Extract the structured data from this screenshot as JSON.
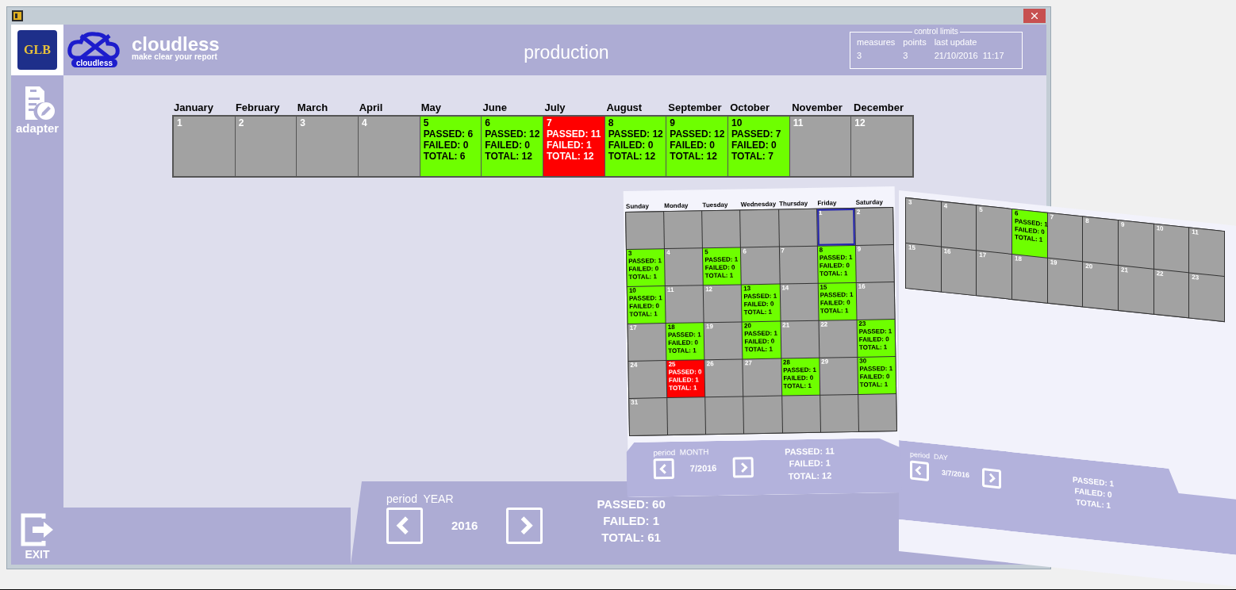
{
  "header": {
    "logo_text": "GLB",
    "brand_badge": "cloudless",
    "brand_name": "cloudless",
    "tagline": "make clear your report",
    "title": "production",
    "control_limits": {
      "legend": "control limits",
      "columns": [
        {
          "label": "measures",
          "value": "3"
        },
        {
          "label": "points",
          "value": "3"
        },
        {
          "label": "last update",
          "value": "21/10/2016  11:17"
        }
      ]
    }
  },
  "sidebar": {
    "items": [
      {
        "kind": "adapter",
        "label": "adapter"
      },
      {
        "kind": "exit",
        "label": "EXIT"
      }
    ]
  },
  "year_view": {
    "months": [
      {
        "name": "January",
        "number": "1",
        "kind": "empty",
        "color": "#a2a2a2"
      },
      {
        "name": "February",
        "number": "2",
        "kind": "empty",
        "color": "#a2a2a2"
      },
      {
        "name": "March",
        "number": "3",
        "kind": "empty",
        "color": "#a2a2a2"
      },
      {
        "name": "April",
        "number": "4",
        "kind": "empty",
        "color": "#a2a2a2"
      },
      {
        "name": "May",
        "number": "5",
        "kind": "pass",
        "color": "#6eff00",
        "lines": [
          "PASSED: 6",
          "FAILED: 0",
          "TOTAL: 6"
        ]
      },
      {
        "name": "June",
        "number": "6",
        "kind": "pass",
        "color": "#6eff00",
        "lines": [
          "PASSED: 12",
          "FAILED: 0",
          "TOTAL: 12"
        ]
      },
      {
        "name": "July",
        "number": "7",
        "kind": "fail",
        "color": "#ff0000",
        "lines": [
          "PASSED: 11",
          "FAILED: 1",
          "TOTAL: 12"
        ]
      },
      {
        "name": "August",
        "number": "8",
        "kind": "pass",
        "color": "#6eff00",
        "lines": [
          "PASSED: 12",
          "FAILED: 0",
          "TOTAL: 12"
        ]
      },
      {
        "name": "September",
        "number": "9",
        "kind": "pass",
        "color": "#6eff00",
        "lines": [
          "PASSED: 12",
          "FAILED: 0",
          "TOTAL: 12"
        ]
      },
      {
        "name": "October",
        "number": "10",
        "kind": "pass",
        "color": "#6eff00",
        "lines": [
          "PASSED: 7",
          "FAILED: 0",
          "TOTAL: 7"
        ]
      },
      {
        "name": "November",
        "number": "11",
        "kind": "empty",
        "color": "#a2a2a2"
      },
      {
        "name": "December",
        "number": "12",
        "kind": "empty",
        "color": "#a2a2a2"
      }
    ],
    "footer": {
      "period_label": "period",
      "period_value": "YEAR",
      "value": "2016",
      "totals": [
        "PASSED: 60",
        "FAILED: 1",
        "TOTAL: 61"
      ]
    }
  },
  "month_view": {
    "weekdays": [
      "Sunday",
      "Monday",
      "Tuesday",
      "Wednesday",
      "Thursday",
      "Friday",
      "Saturday"
    ],
    "cells": [
      {
        "kind": "empty",
        "color": "#a2a2a2",
        "selected": false
      },
      {
        "kind": "empty",
        "color": "#a2a2a2",
        "selected": false
      },
      {
        "kind": "empty",
        "color": "#a2a2a2",
        "selected": false
      },
      {
        "kind": "empty",
        "color": "#a2a2a2",
        "selected": false
      },
      {
        "kind": "empty",
        "color": "#a2a2a2",
        "selected": false
      },
      {
        "number": "1",
        "kind": "empty",
        "color": "#a2a2a2",
        "selected": true
      },
      {
        "number": "2",
        "kind": "empty",
        "color": "#a2a2a2",
        "selected": false
      },
      {
        "number": "3",
        "kind": "pass",
        "color": "#6eff00",
        "selected": false,
        "lines": [
          "PASSED: 1",
          "FAILED: 0",
          "TOTAL: 1"
        ]
      },
      {
        "number": "4",
        "kind": "empty",
        "color": "#a2a2a2",
        "selected": false
      },
      {
        "number": "5",
        "kind": "pass",
        "color": "#6eff00",
        "selected": false,
        "lines": [
          "PASSED: 1",
          "FAILED: 0",
          "TOTAL: 1"
        ]
      },
      {
        "number": "6",
        "kind": "empty",
        "color": "#a2a2a2",
        "selected": false
      },
      {
        "number": "7",
        "kind": "empty",
        "color": "#a2a2a2",
        "selected": false
      },
      {
        "number": "8",
        "kind": "pass",
        "color": "#6eff00",
        "selected": false,
        "lines": [
          "PASSED: 1",
          "FAILED: 0",
          "TOTAL: 1"
        ]
      },
      {
        "number": "9",
        "kind": "empty",
        "color": "#a2a2a2",
        "selected": false
      },
      {
        "number": "10",
        "kind": "pass",
        "color": "#6eff00",
        "selected": false,
        "lines": [
          "PASSED: 1",
          "FAILED: 0",
          "TOTAL: 1"
        ]
      },
      {
        "number": "11",
        "kind": "empty",
        "color": "#a2a2a2",
        "selected": false
      },
      {
        "number": "12",
        "kind": "empty",
        "color": "#a2a2a2",
        "selected": false
      },
      {
        "number": "13",
        "kind": "pass",
        "color": "#6eff00",
        "selected": false,
        "lines": [
          "PASSED: 1",
          "FAILED: 0",
          "TOTAL: 1"
        ]
      },
      {
        "number": "14",
        "kind": "empty",
        "color": "#a2a2a2",
        "selected": false
      },
      {
        "number": "15",
        "kind": "pass",
        "color": "#6eff00",
        "selected": false,
        "lines": [
          "PASSED: 1",
          "FAILED: 0",
          "TOTAL: 1"
        ]
      },
      {
        "number": "16",
        "kind": "empty",
        "color": "#a2a2a2",
        "selected": false
      },
      {
        "number": "17",
        "kind": "empty",
        "color": "#a2a2a2",
        "selected": false
      },
      {
        "number": "18",
        "kind": "pass",
        "color": "#6eff00",
        "selected": false,
        "lines": [
          "PASSED: 1",
          "FAILED: 0",
          "TOTAL: 1"
        ]
      },
      {
        "number": "19",
        "kind": "empty",
        "color": "#a2a2a2",
        "selected": false
      },
      {
        "number": "20",
        "kind": "pass",
        "color": "#6eff00",
        "selected": false,
        "lines": [
          "PASSED: 1",
          "FAILED: 0",
          "TOTAL: 1"
        ]
      },
      {
        "number": "21",
        "kind": "empty",
        "color": "#a2a2a2",
        "selected": false
      },
      {
        "number": "22",
        "kind": "empty",
        "color": "#a2a2a2",
        "selected": false
      },
      {
        "number": "23",
        "kind": "pass",
        "color": "#6eff00",
        "selected": false,
        "lines": [
          "PASSED: 1",
          "FAILED: 0",
          "TOTAL: 1"
        ]
      },
      {
        "number": "24",
        "kind": "empty",
        "color": "#a2a2a2",
        "selected": false
      },
      {
        "number": "25",
        "kind": "fail",
        "color": "#ff0000",
        "selected": false,
        "lines": [
          "PASSED: 0",
          "FAILED: 1",
          "TOTAL: 1"
        ]
      },
      {
        "number": "26",
        "kind": "empty",
        "color": "#a2a2a2",
        "selected": false
      },
      {
        "number": "27",
        "kind": "empty",
        "color": "#a2a2a2",
        "selected": false
      },
      {
        "number": "28",
        "kind": "pass",
        "color": "#6eff00",
        "selected": false,
        "lines": [
          "PASSED: 1",
          "FAILED: 0",
          "TOTAL: 1"
        ]
      },
      {
        "number": "29",
        "kind": "empty",
        "color": "#a2a2a2",
        "selected": false
      },
      {
        "number": "30",
        "kind": "pass",
        "color": "#6eff00",
        "selected": false,
        "lines": [
          "PASSED: 1",
          "FAILED: 0",
          "TOTAL: 1"
        ]
      },
      {
        "number": "31",
        "kind": "empty",
        "color": "#a2a2a2",
        "selected": false
      },
      {
        "kind": "empty",
        "color": "#a2a2a2",
        "selected": false
      },
      {
        "kind": "empty",
        "color": "#a2a2a2",
        "selected": false
      },
      {
        "kind": "empty",
        "color": "#a2a2a2",
        "selected": false
      },
      {
        "kind": "empty",
        "color": "#a2a2a2",
        "selected": false
      },
      {
        "kind": "empty",
        "color": "#a2a2a2",
        "selected": false
      },
      {
        "kind": "empty",
        "color": "#a2a2a2",
        "selected": false
      }
    ],
    "footer": {
      "period_label": "period",
      "period_value": "MONTH",
      "value": "7/2016",
      "totals": [
        "PASSED: 11",
        "FAILED: 1",
        "TOTAL: 12"
      ]
    }
  },
  "day_view": {
    "cells": [
      {
        "number": "3",
        "kind": "empty",
        "color": "#a2a2a2"
      },
      {
        "number": "4",
        "kind": "empty",
        "color": "#a2a2a2"
      },
      {
        "number": "5",
        "kind": "empty",
        "color": "#a2a2a2"
      },
      {
        "number": "6",
        "kind": "pass",
        "color": "#6eff00",
        "lines": [
          "PASSED: 1",
          "FAILED: 0",
          "TOTAL: 1"
        ]
      },
      {
        "number": "7",
        "kind": "empty",
        "color": "#a2a2a2"
      },
      {
        "number": "8",
        "kind": "empty",
        "color": "#a2a2a2"
      },
      {
        "number": "9",
        "kind": "empty",
        "color": "#a2a2a2"
      },
      {
        "number": "10",
        "kind": "empty",
        "color": "#a2a2a2"
      },
      {
        "number": "11",
        "kind": "empty",
        "color": "#a2a2a2"
      },
      {
        "number": "15",
        "kind": "empty",
        "color": "#a2a2a2"
      },
      {
        "number": "16",
        "kind": "empty",
        "color": "#a2a2a2"
      },
      {
        "number": "17",
        "kind": "empty",
        "color": "#a2a2a2"
      },
      {
        "number": "18",
        "kind": "empty",
        "color": "#a2a2a2"
      },
      {
        "number": "19",
        "kind": "empty",
        "color": "#a2a2a2"
      },
      {
        "number": "20",
        "kind": "empty",
        "color": "#a2a2a2"
      },
      {
        "number": "21",
        "kind": "empty",
        "color": "#a2a2a2"
      },
      {
        "number": "22",
        "kind": "empty",
        "color": "#a2a2a2"
      },
      {
        "number": "23",
        "kind": "empty",
        "color": "#a2a2a2"
      }
    ],
    "footer": {
      "period_label": "period",
      "period_value": "DAY",
      "value": "3/7/2016",
      "totals": [
        "PASSED: 1",
        "FAILED: 0",
        "TOTAL: 1"
      ]
    }
  }
}
